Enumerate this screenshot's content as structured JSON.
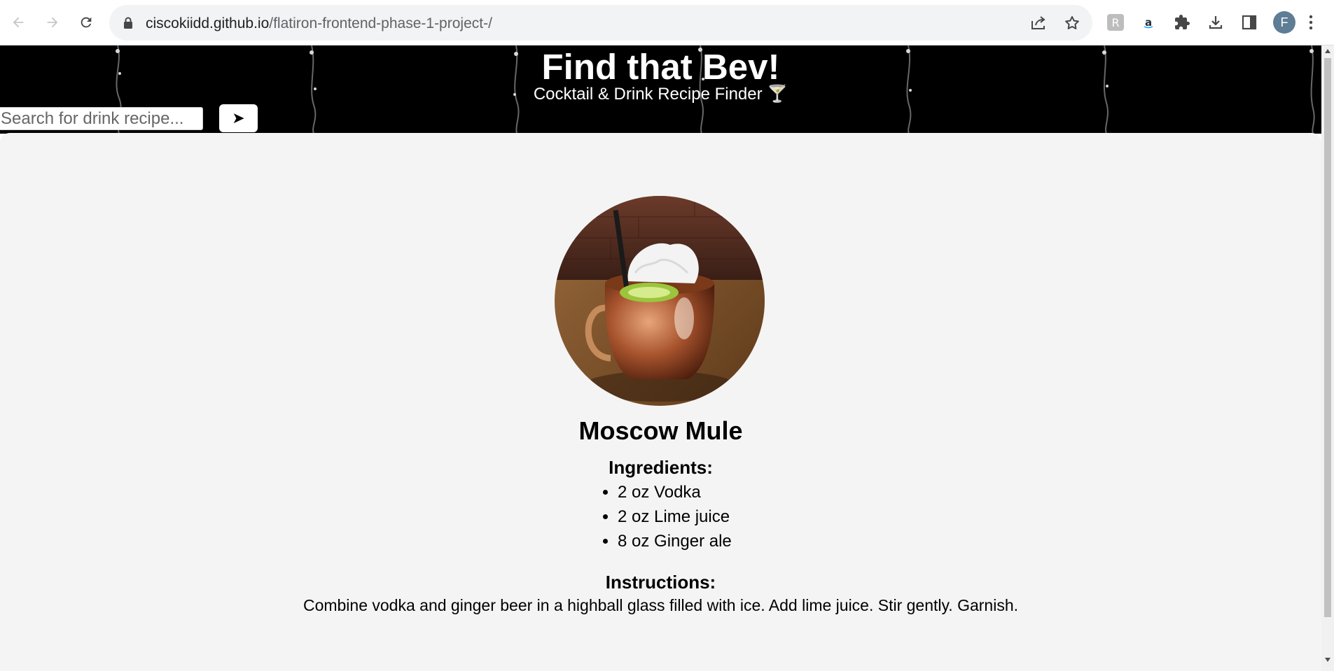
{
  "browser": {
    "url_host": "ciscokiidd.github.io",
    "url_path": "/flatiron-frontend-phase-1-project-/",
    "profile_initial": "F",
    "icons": [
      "back-arrow-icon",
      "forward-arrow-icon",
      "reload-icon",
      "lock-icon",
      "share-icon",
      "bookmark-star-icon",
      "extension-icon",
      "amazon-assistant-icon",
      "puzzle-icon",
      "download-icon",
      "side-panel-icon",
      "more-vert-icon"
    ]
  },
  "header": {
    "title": "Find that Bev!",
    "subtitle": "Cocktail & Drink Recipe Finder 🍸",
    "search_placeholder": "Search for drink recipe...",
    "search_button": "➤"
  },
  "drink": {
    "name": "Moscow Mule",
    "ingredients_heading": "Ingredients:",
    "ingredients": [
      "2 oz Vodka",
      "2 oz Lime juice",
      "8 oz Ginger ale"
    ],
    "instructions_heading": "Instructions:",
    "instructions": "Combine vodka and ginger beer in a highball glass filled with ice. Add lime juice. Stir gently. Garnish."
  },
  "colors": {
    "header_bg": "#000000",
    "content_bg": "#f4f4f4",
    "omnibox_bg": "#f1f3f4",
    "avatar_bg": "#5f7d95"
  }
}
